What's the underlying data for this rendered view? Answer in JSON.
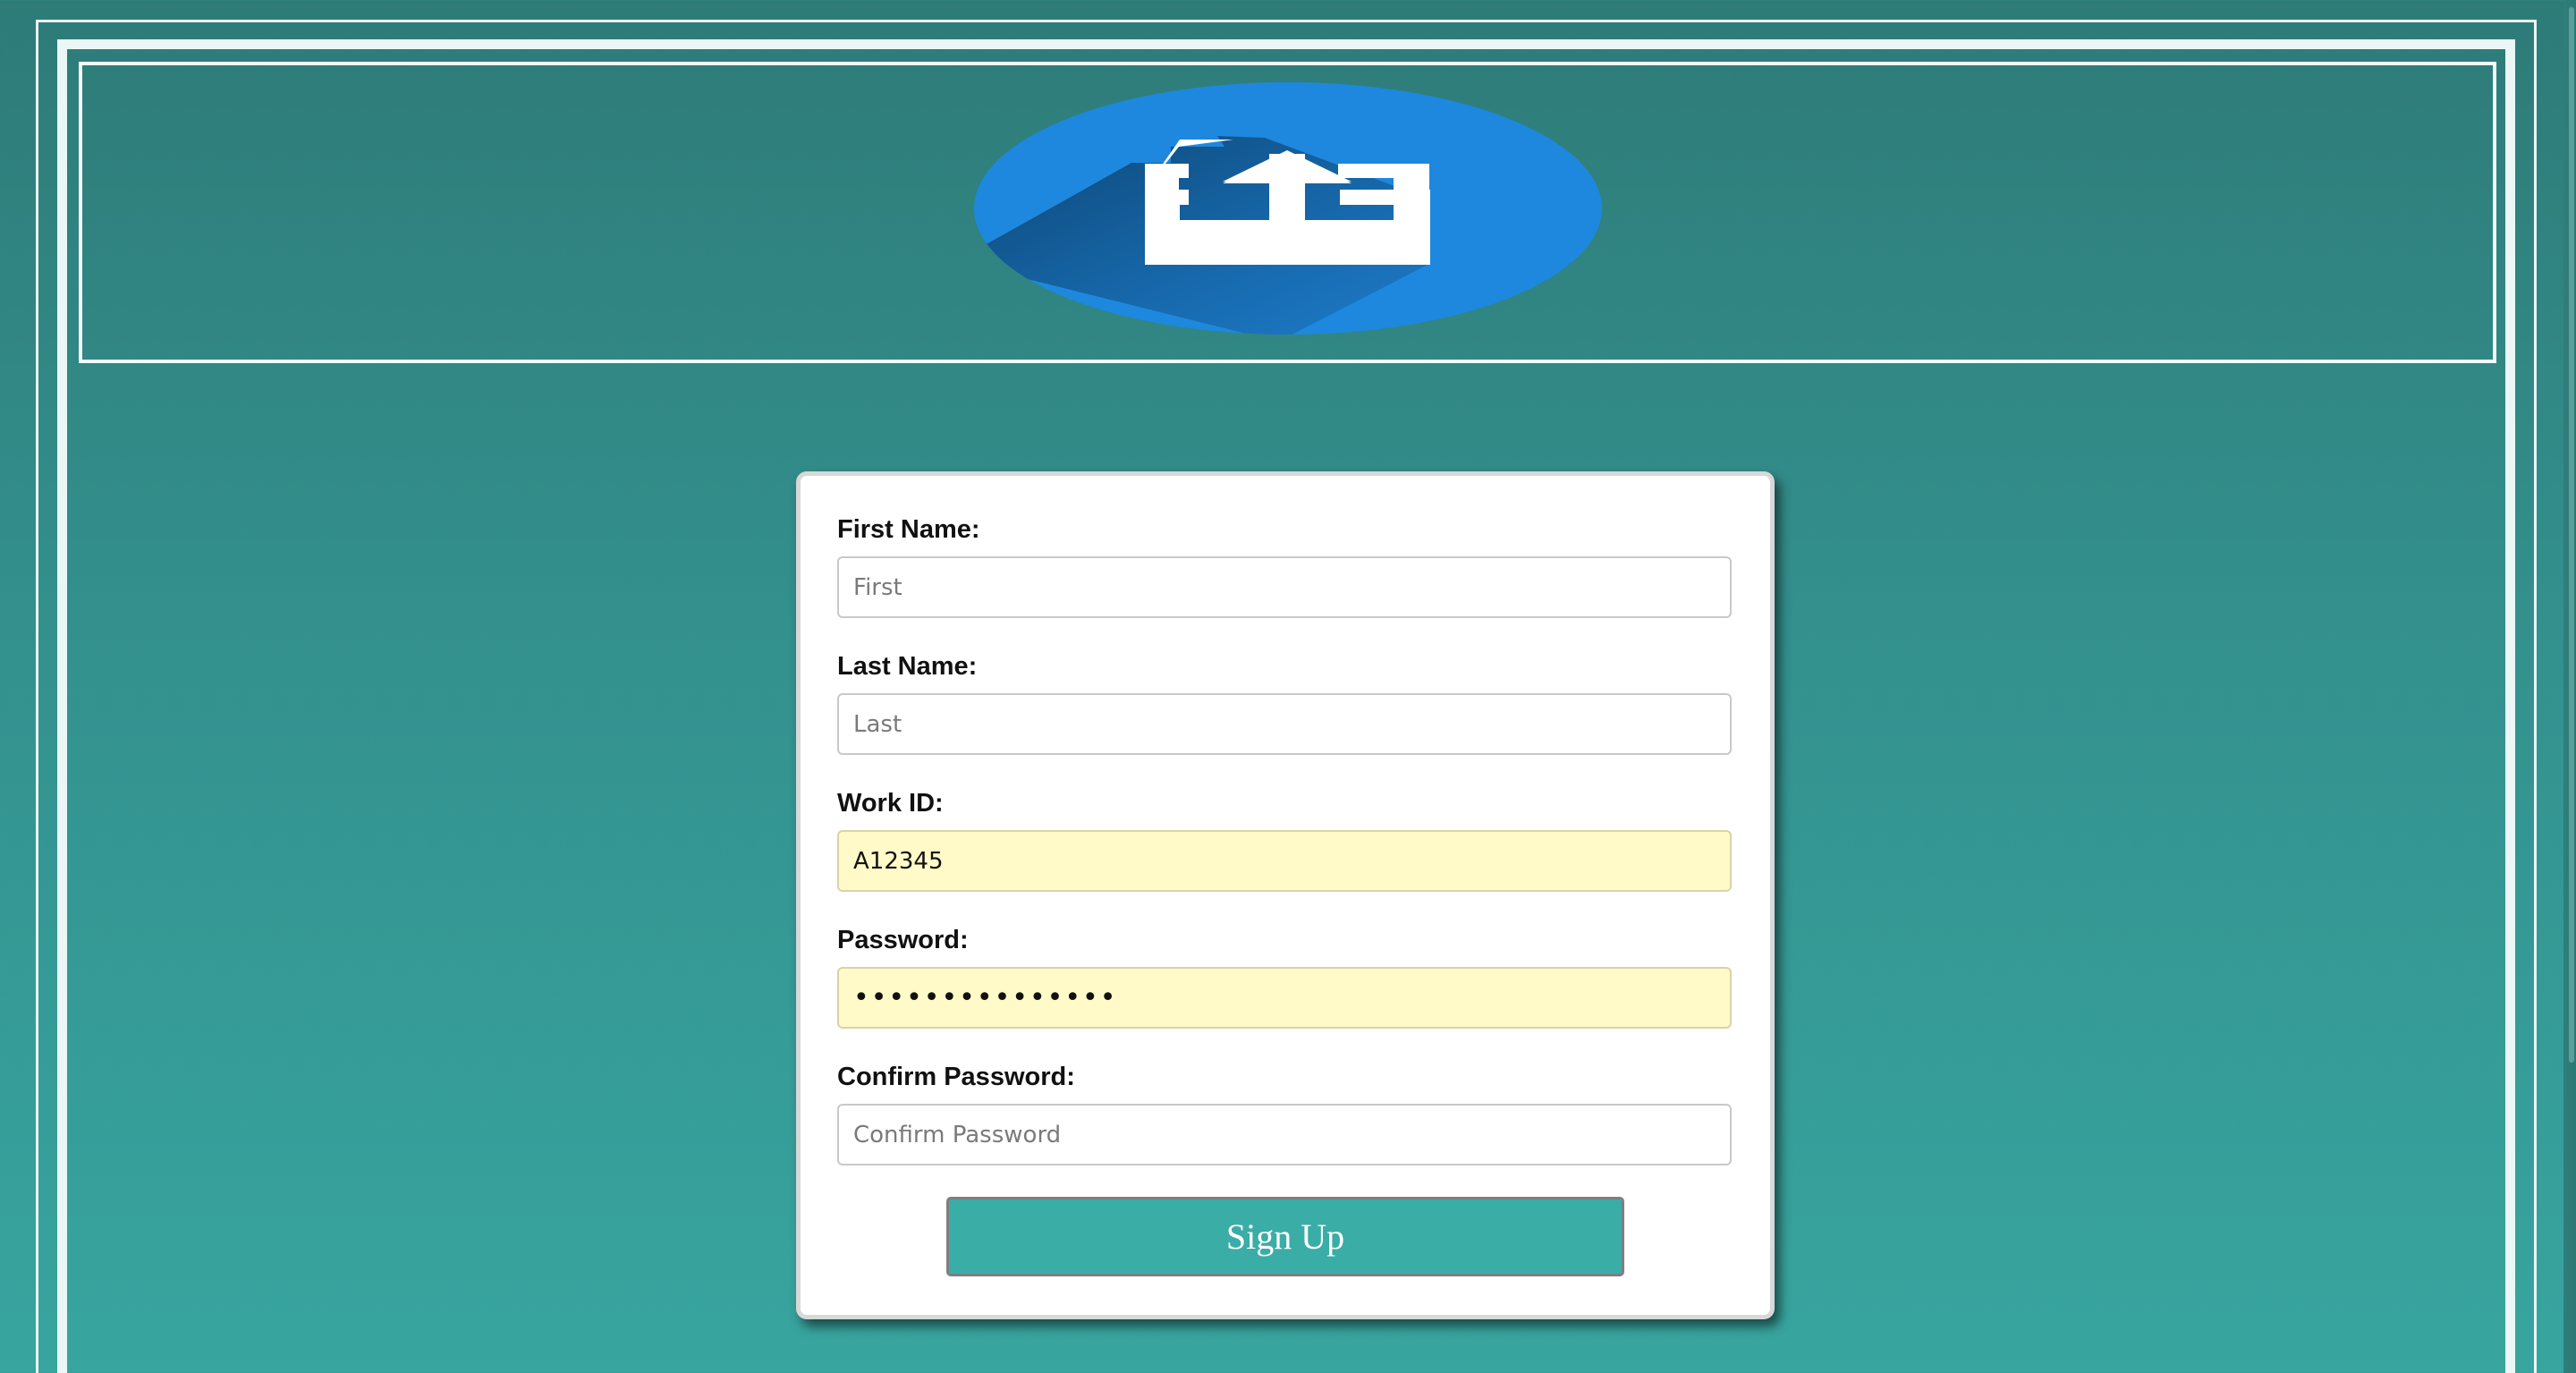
{
  "header": {
    "logo_icon": "upload-icon",
    "logo_color": "#1e88de"
  },
  "form": {
    "first_name": {
      "label": "First Name:",
      "placeholder": "First",
      "value": ""
    },
    "last_name": {
      "label": "Last Name:",
      "placeholder": "Last",
      "value": ""
    },
    "work_id": {
      "label": "Work ID:",
      "placeholder": "",
      "value": "A12345"
    },
    "password": {
      "label": "Password:",
      "placeholder": "",
      "value": "abcdefghijklmno"
    },
    "confirm_password": {
      "label": "Confirm Password:",
      "placeholder": "Confirm Password",
      "value": ""
    },
    "submit_label": "Sign Up"
  },
  "colors": {
    "background_top": "#2e7b78",
    "background_bottom": "#38a59f",
    "button": "#3aada7",
    "autofill": "#fffac8"
  }
}
